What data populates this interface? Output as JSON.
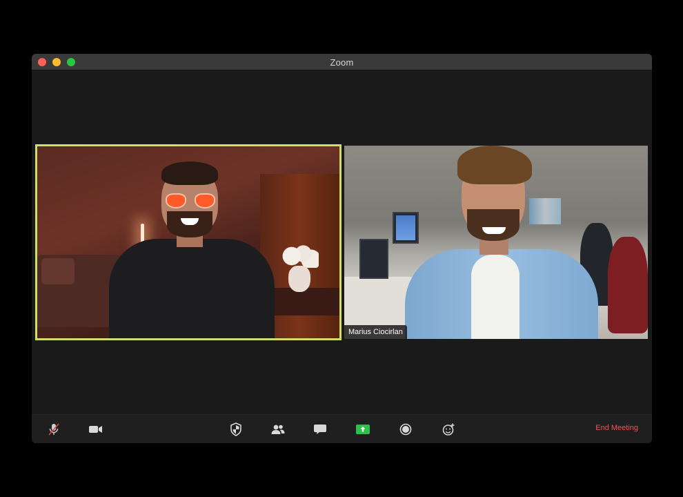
{
  "window": {
    "title": "Zoom"
  },
  "participants": {
    "left": {
      "name": "",
      "active_speaker": true
    },
    "right": {
      "name": "Marius Ciocirlan",
      "active_speaker": false
    }
  },
  "toolbar": {
    "icons": [
      "muted-mic-icon",
      "video-camera-icon",
      "security-shield-icon",
      "participants-icon",
      "chat-icon",
      "share-screen-icon",
      "record-icon",
      "reactions-icon"
    ],
    "end_meeting_label": "End Meeting"
  },
  "colors": {
    "active_speaker_border": "#cfe066",
    "share_screen_green": "#2fbf4a",
    "end_meeting": "#f05454",
    "traffic_close": "#fe5f57",
    "traffic_min": "#febc2e",
    "traffic_max": "#28c840"
  }
}
